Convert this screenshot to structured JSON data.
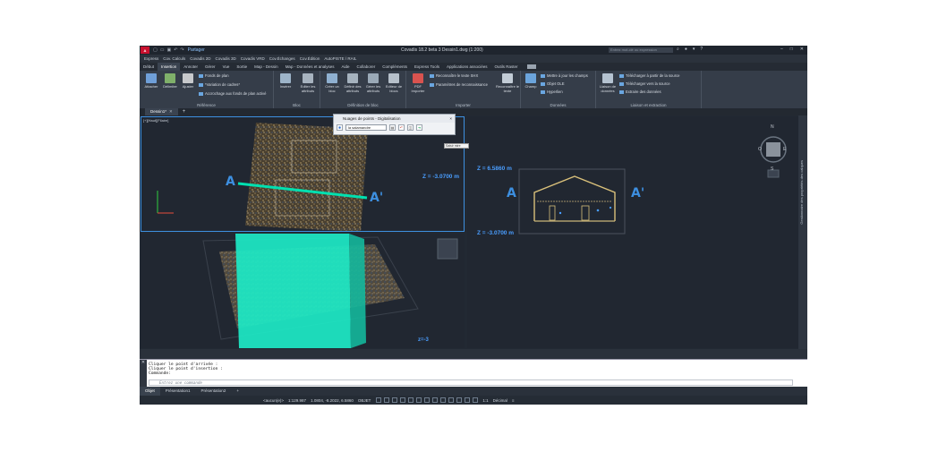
{
  "titlebar": {
    "logo": "A",
    "share_label": "Partager",
    "window_title": "Covadis 18.2 beta 3   Dessin1.dwg (1:200)",
    "search_placeholder": "Entrez mot-clé ou expression"
  },
  "menubar": [
    "Express",
    "Cov. Calculs",
    "Covadis 2D",
    "Covadis 3D",
    "Covadis VRD",
    "Cov.Échanges",
    "Cov.Édition",
    "AutoPISTE / RAIL"
  ],
  "ribbon_tabs": [
    "Début",
    "Insertion",
    "Annoter",
    "Gérer",
    "Vue",
    "Sortie",
    "Map - Dessin",
    "Map - Données et analyses",
    "Aide",
    "Collaborer",
    "Compléments",
    "Express Tools",
    "Applications associées",
    "Outils Raster"
  ],
  "active_ribbon_tab": "Insertion",
  "ribbon": {
    "reference": {
      "label": "Référence",
      "buttons": [
        "Attacher",
        "Délimiter",
        "Ajuster"
      ],
      "small": [
        "Fonds de plan",
        "*Variation de cadres*",
        "Accrochage aux fonds de plan activé"
      ]
    },
    "bloc": {
      "label": "Bloc",
      "buttons": [
        "Insérer",
        "Editer les attributs"
      ]
    },
    "definition": {
      "label": "Définition de bloc",
      "buttons": [
        "Créer un bloc",
        "Définir des attributs",
        "Gérer les attributs",
        "Editeur de blocs"
      ]
    },
    "importer": {
      "label": "Importer",
      "buttons": [
        "PDF Importer",
        "Reconnaître le texte"
      ],
      "small": [
        "Reconnaître le texte SHX",
        "Paramètres de reconnaissance"
      ]
    },
    "donnees": {
      "label": "Données",
      "buttons": [
        "Champ"
      ],
      "small": [
        "Mettre à jour les champs",
        "Objet OLE",
        "Hyperlien"
      ]
    },
    "liaison": {
      "label": "Liaison et extraction",
      "buttons": [
        "Liaison de données"
      ],
      "small": [
        "Télécharger à partir de la source",
        "Télécharger vers la source",
        "Extraire des données"
      ]
    }
  },
  "doc_tab": "Dessin1*",
  "viewports": {
    "top_left_label": "[+][Haut][Filaire]",
    "section_start": "A",
    "section_end": "A'",
    "z_left": "Z = -3.0700 m",
    "z_top": "Z = 6.5860 m",
    "z_bottom": "Z = -3.0700 m"
  },
  "floating_toolbar": {
    "title": "Nuages de points - Digitalisation",
    "close": "×",
    "layer_value": "la salamandre",
    "tooltip": "Saisir mire"
  },
  "right_palette_label": "Gestionnaire des propriétés des calques",
  "command": {
    "lines": [
      "Cliquer le point d'arrivée :",
      "Cliquer le point d'insertion :",
      "Commande:"
    ],
    "placeholder": "Entrez une commande"
  },
  "layout_tabs": [
    "Objet",
    "Présentation1",
    "Présentation2"
  ],
  "status": {
    "scale": "1:129.987",
    "coords": "1.0804, -8.2022, 6.5860",
    "objet": "OBJET",
    "aucun": "<aucun(e)>",
    "decimal": "Décimal",
    "ratio": "1:1"
  },
  "colors": {
    "accent": "#3d8fe0",
    "section_line": "#00e0b0",
    "section_plane": "#1de9c5",
    "background": "#2b3340"
  }
}
